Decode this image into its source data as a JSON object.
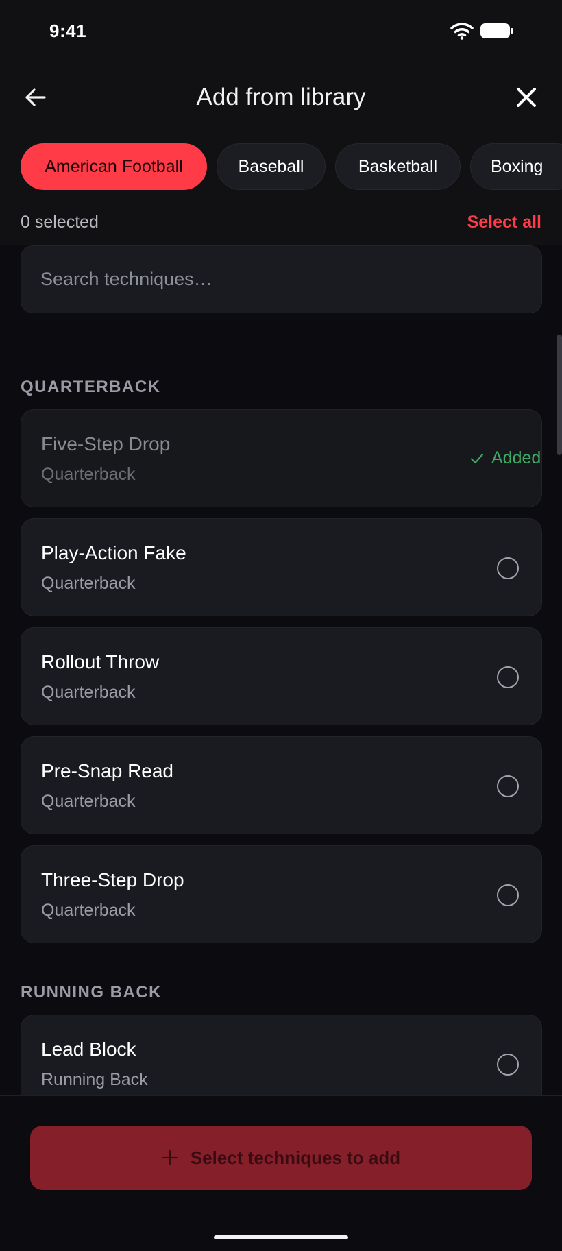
{
  "status_bar": {
    "time": "9:41"
  },
  "header": {
    "title": "Add from library"
  },
  "categories": [
    "American Football",
    "Baseball",
    "Basketball",
    "Boxing"
  ],
  "selection": {
    "count_label": "0 selected",
    "select_all_label": "Select all"
  },
  "search": {
    "placeholder": "Search techniques…",
    "value": ""
  },
  "sections": [
    {
      "title": "QUARTERBACK",
      "items": [
        {
          "name": "Five-Step Drop",
          "position": "Quarterback",
          "added": true,
          "status_label": "Added"
        },
        {
          "name": "Play-Action Fake",
          "position": "Quarterback",
          "added": false
        },
        {
          "name": "Rollout Throw",
          "position": "Quarterback",
          "added": false
        },
        {
          "name": "Pre-Snap Read",
          "position": "Quarterback",
          "added": false
        },
        {
          "name": "Three-Step Drop",
          "position": "Quarterback",
          "added": false
        }
      ]
    },
    {
      "title": "RUNNING BACK",
      "items": [
        {
          "name": "Lead Block",
          "position": "Running Back",
          "added": false
        }
      ]
    }
  ],
  "footer": {
    "add_button_label": "Select techniques to add",
    "disabled": true
  },
  "colors": {
    "accent": "#ff3b47",
    "added": "#3ea865",
    "background": "#0c0c10",
    "card": "#1a1b20",
    "button_disabled": "#85202a"
  },
  "icons": {
    "back": "arrow-left-icon",
    "close": "close-icon",
    "wifi": "wifi-icon",
    "battery": "battery-icon",
    "added": "check-icon",
    "add": "plus-icon"
  }
}
